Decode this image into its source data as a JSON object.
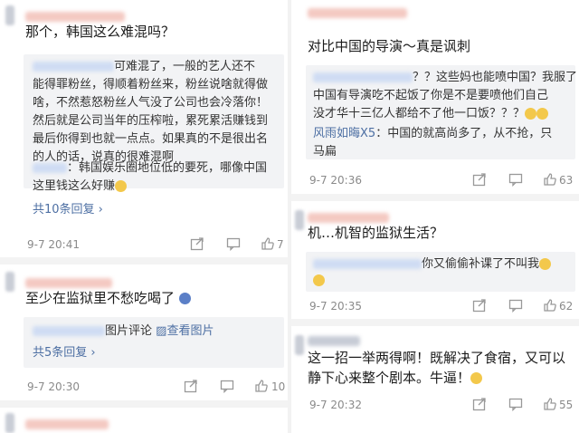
{
  "left": {
    "c1": {
      "title": "那个，韩国这么难混吗？",
      "quote1_line1": "可难混了，一般的艺人还不",
      "quote1_lines": [
        "能得罪粉丝，得顺着粉丝来，粉丝说啥就得做",
        "啥，不然惹怒粉丝人气没了公司也会冷落你！",
        "然后就是公司当年的压榨啦，累死累活赚钱到",
        "最后你得到也就一点点。如果真的不是很出名",
        "的人的话，说真的很难混啊"
      ],
      "quote2_line1": "：韩国娱乐圈地位低的要死，哪像中国",
      "quote2_line2": "这里钱这么好赚",
      "more": "共10条回复 ›",
      "time": "9-7 20:41",
      "like": "7"
    },
    "c2": {
      "title": "至少在监狱里不愁吃喝了",
      "quote_text": "图片评论",
      "quote_link": "查看图片",
      "more": "共5条回复 ›",
      "time": "9-7 20:30",
      "like": "10"
    }
  },
  "right": {
    "c1": {
      "title": "对比中国的导演～真是讽刺",
      "reply_line1": "？？这些妈也能喷中国？我服了",
      "reply_lines": [
        "中国有导演吃不起饭了你是不是要喷他们自己",
        "没才华十三亿人都给不了他一口饭？？？"
      ],
      "sub_name": "风雨如晦X5",
      "sub_text": "：中国的就高尚多了，从不抢，只",
      "sub_text2": "马扁",
      "time": "9-7 20:36",
      "like": "63"
    },
    "c2": {
      "title": "机…机智的监狱生活？",
      "quote_text": "你又偷偷补课了不叫我",
      "time": "9-7 20:35",
      "like": "62"
    },
    "c3": {
      "title_line1": "这一招一举两得啊！既解决了食宿，又可以",
      "title_line2": "静下心来整个剧本。牛逼！",
      "time": "9-7 20:32",
      "like": "55"
    }
  }
}
